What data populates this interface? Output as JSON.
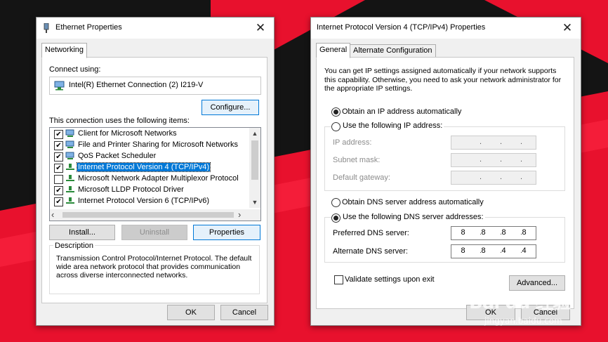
{
  "ethernet": {
    "title": "Ethernet Properties",
    "tab": "Networking",
    "connect_using_label": "Connect using:",
    "adapter_name": "Intel(R) Ethernet Connection (2) I219-V",
    "configure_label": "Configure...",
    "items_label": "This connection uses the following items:",
    "items": [
      {
        "label": "Client for Microsoft Networks",
        "checked": true,
        "icon": "client-network-icon"
      },
      {
        "label": "File and Printer Sharing for Microsoft Networks",
        "checked": true,
        "icon": "file-sharing-icon"
      },
      {
        "label": "QoS Packet Scheduler",
        "checked": true,
        "icon": "qos-icon"
      },
      {
        "label": "Internet Protocol Version 4 (TCP/IPv4)",
        "checked": true,
        "icon": "protocol-icon",
        "selected": true
      },
      {
        "label": "Microsoft Network Adapter Multiplexor Protocol",
        "checked": false,
        "icon": "protocol-icon"
      },
      {
        "label": "Microsoft LLDP Protocol Driver",
        "checked": true,
        "icon": "protocol-icon"
      },
      {
        "label": "Internet Protocol Version 6 (TCP/IPv6)",
        "checked": true,
        "icon": "protocol-icon"
      }
    ],
    "install_label": "Install...",
    "uninstall_label": "Uninstall",
    "properties_label": "Properties",
    "description_label": "Description",
    "description_text": "Transmission Control Protocol/Internet Protocol. The default wide area network protocol that provides communication across diverse interconnected networks.",
    "ok_label": "OK",
    "cancel_label": "Cancel"
  },
  "ipv4": {
    "title": "Internet Protocol Version 4 (TCP/IPv4) Properties",
    "tabs": [
      "General",
      "Alternate Configuration"
    ],
    "intro": "You can get IP settings assigned automatically if your network supports this capability. Otherwise, you need to ask your network administrator for the appropriate IP settings.",
    "obtain_ip_auto": "Obtain an IP address automatically",
    "use_following_ip": "Use the following IP address:",
    "ip_address_label": "IP address:",
    "subnet_mask_label": "Subnet mask:",
    "default_gateway_label": "Default gateway:",
    "obtain_dns_auto": "Obtain DNS server address automatically",
    "use_following_dns": "Use the following DNS server addresses:",
    "preferred_dns_label": "Preferred DNS server:",
    "alternate_dns_label": "Alternate DNS server:",
    "preferred_dns": [
      "8",
      "8",
      "8",
      "8"
    ],
    "alternate_dns": [
      "8",
      "8",
      "4",
      "4"
    ],
    "validate_label": "Validate settings upon exit",
    "advanced_label": "Advanced...",
    "ok_label": "OK",
    "cancel_label": "Cancel"
  },
  "watermark": {
    "text": "Bai du 经验",
    "url": "jingyan.baidu.com"
  },
  "colors": {
    "accent": "#0078d7",
    "bg_red": "#e8112d",
    "bg_black": "#111111"
  }
}
